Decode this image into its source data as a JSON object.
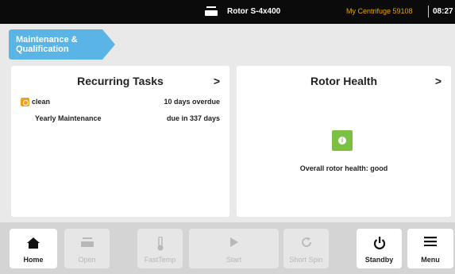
{
  "topbar": {
    "rotor_name": "Rotor S-4x400",
    "device_name": "My Centrifuge 59108",
    "time": "08:27",
    "rotor_icon": "rotor-icon"
  },
  "breadcrumb": {
    "label": "Maintenance & Qualification",
    "color": "#5ab4e6"
  },
  "recurring_tasks": {
    "title": "Recurring Tasks",
    "chevron": ">",
    "items": [
      {
        "name": "clean",
        "due": "10 days overdue",
        "icon": "warning-icon",
        "icon_color": "#f0a020"
      },
      {
        "name": "Yearly Maintenance",
        "due": "due in 337 days"
      }
    ]
  },
  "rotor_health": {
    "title": "Rotor Health",
    "chevron": ">",
    "status_icon": "info-icon",
    "status_color": "#7bc043",
    "status_text": "Overall rotor health: good"
  },
  "nav": [
    {
      "id": "home",
      "label": "Home",
      "icon": "home-icon",
      "enabled": true
    },
    {
      "id": "open",
      "label": "Open",
      "icon": "lid-icon",
      "enabled": false
    },
    {
      "id": "fasttemp",
      "label": "FastTemp",
      "icon": "thermometer-icon",
      "enabled": false
    },
    {
      "id": "start",
      "label": "Start",
      "icon": "play-icon",
      "enabled": false
    },
    {
      "id": "shortspin",
      "label": "Short Spin",
      "icon": "refresh-icon",
      "enabled": false
    },
    {
      "id": "standby",
      "label": "Standby",
      "icon": "power-icon",
      "enabled": true
    },
    {
      "id": "menu",
      "label": "Menu",
      "icon": "hamburger-icon",
      "enabled": true
    }
  ]
}
